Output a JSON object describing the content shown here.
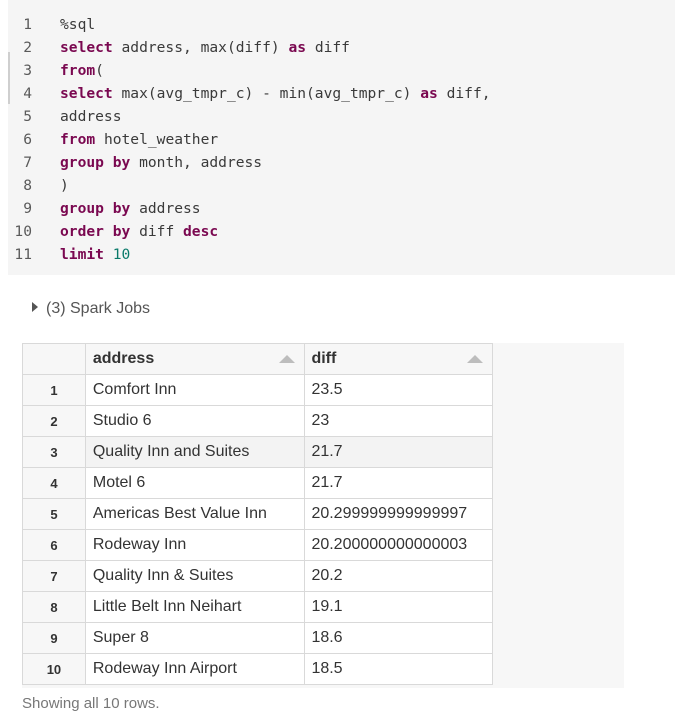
{
  "code": {
    "lines": [
      {
        "num": "1",
        "parts": [
          {
            "t": "%sql",
            "c": ""
          }
        ]
      },
      {
        "num": "2",
        "parts": [
          {
            "t": "select",
            "c": "kw"
          },
          {
            "t": " address, max(diff) ",
            "c": ""
          },
          {
            "t": "as",
            "c": "kw"
          },
          {
            "t": " diff",
            "c": ""
          }
        ]
      },
      {
        "num": "3",
        "parts": [
          {
            "t": "from",
            "c": "kw"
          },
          {
            "t": "(",
            "c": ""
          }
        ]
      },
      {
        "num": "4",
        "parts": [
          {
            "t": "select",
            "c": "kw"
          },
          {
            "t": " max(avg_tmpr_c) - min(avg_tmpr_c) ",
            "c": ""
          },
          {
            "t": "as",
            "c": "kw"
          },
          {
            "t": " diff,",
            "c": ""
          }
        ]
      },
      {
        "num": "5",
        "parts": [
          {
            "t": "address",
            "c": ""
          }
        ]
      },
      {
        "num": "6",
        "parts": [
          {
            "t": "from",
            "c": "kw"
          },
          {
            "t": " hotel_weather",
            "c": ""
          }
        ]
      },
      {
        "num": "7",
        "parts": [
          {
            "t": "group by",
            "c": "kw"
          },
          {
            "t": " month, address",
            "c": ""
          }
        ]
      },
      {
        "num": "8",
        "parts": [
          {
            "t": ")",
            "c": ""
          }
        ]
      },
      {
        "num": "9",
        "parts": [
          {
            "t": "group by",
            "c": "kw"
          },
          {
            "t": " address",
            "c": ""
          }
        ]
      },
      {
        "num": "10",
        "parts": [
          {
            "t": "order by",
            "c": "kw"
          },
          {
            "t": " diff ",
            "c": ""
          },
          {
            "t": "desc",
            "c": "kw"
          }
        ]
      },
      {
        "num": "11",
        "parts": [
          {
            "t": "limit",
            "c": "kw"
          },
          {
            "t": " ",
            "c": ""
          },
          {
            "t": "10",
            "c": "num"
          }
        ]
      }
    ]
  },
  "spark_jobs": {
    "label": "(3) Spark Jobs"
  },
  "table": {
    "columns": [
      "address",
      "diff"
    ],
    "rows": [
      {
        "idx": "1",
        "address": "Comfort Inn",
        "diff": "23.5"
      },
      {
        "idx": "2",
        "address": "Studio 6",
        "diff": "23"
      },
      {
        "idx": "3",
        "address": "Quality Inn and Suites",
        "diff": "21.7"
      },
      {
        "idx": "4",
        "address": "Motel 6",
        "diff": "21.7"
      },
      {
        "idx": "5",
        "address": "Americas Best Value Inn",
        "diff": "20.299999999999997"
      },
      {
        "idx": "6",
        "address": "Rodeway Inn",
        "diff": "20.200000000000003"
      },
      {
        "idx": "7",
        "address": "Quality Inn & Suites",
        "diff": "20.2"
      },
      {
        "idx": "8",
        "address": "Little Belt Inn Neihart",
        "diff": "19.1"
      },
      {
        "idx": "9",
        "address": "Super 8",
        "diff": "18.6"
      },
      {
        "idx": "10",
        "address": "Rodeway Inn Airport",
        "diff": "18.5"
      }
    ],
    "highlighted_row": 3
  },
  "footer": {
    "text": "Showing all 10 rows."
  }
}
